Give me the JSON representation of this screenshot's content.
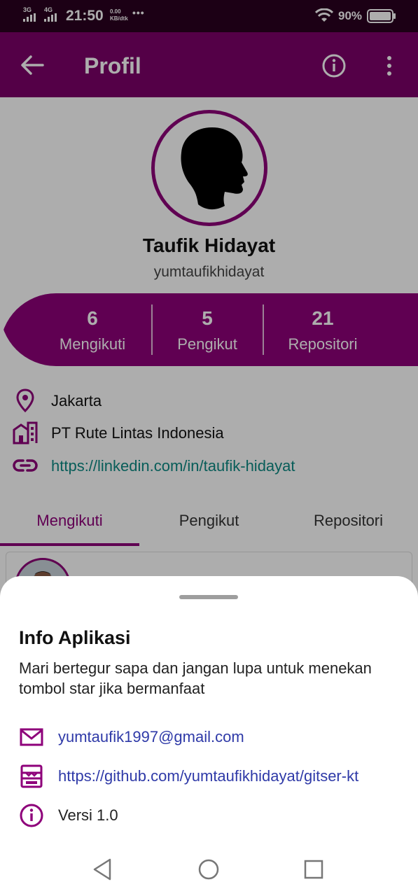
{
  "status_bar": {
    "sig1": "3G",
    "sig2": "4G",
    "time": "21:50",
    "speed_value": "0.00",
    "speed_unit": "KB/dtk",
    "more": "•••",
    "battery": "90%"
  },
  "appbar": {
    "title": "Profil",
    "back_icon": "arrow-left",
    "info_icon": "info-circle",
    "menu_icon": "more-vert"
  },
  "profile": {
    "name": "Taufik Hidayat",
    "username": "yumtaufikhidayat",
    "stats": [
      {
        "value": "6",
        "label": "Mengikuti"
      },
      {
        "value": "5",
        "label": "Pengikut"
      },
      {
        "value": "21",
        "label": "Repositori"
      }
    ],
    "location": "Jakarta",
    "company": "PT Rute Lintas Indonesia",
    "blog": "https://linkedin.com/in/taufik-hidayat"
  },
  "tabs": [
    {
      "label": "Mengikuti",
      "active": true
    },
    {
      "label": "Pengikut",
      "active": false
    },
    {
      "label": "Repositori",
      "active": false
    }
  ],
  "sheet": {
    "title": "Info Aplikasi",
    "description": "Mari bertegur sapa dan jangan lupa untuk menekan tombol star jika bermanfaat",
    "email": "yumtaufik1997@gmail.com",
    "repo": "https://github.com/yumtaufikhidayat/gitser-kt",
    "version": "Versi 1.0"
  },
  "colors": {
    "primary": "#8e007a",
    "appbar": "#7c0069",
    "status": "#2a0020",
    "link": "#0d8a83",
    "sheet_link": "#2f3aa8"
  }
}
